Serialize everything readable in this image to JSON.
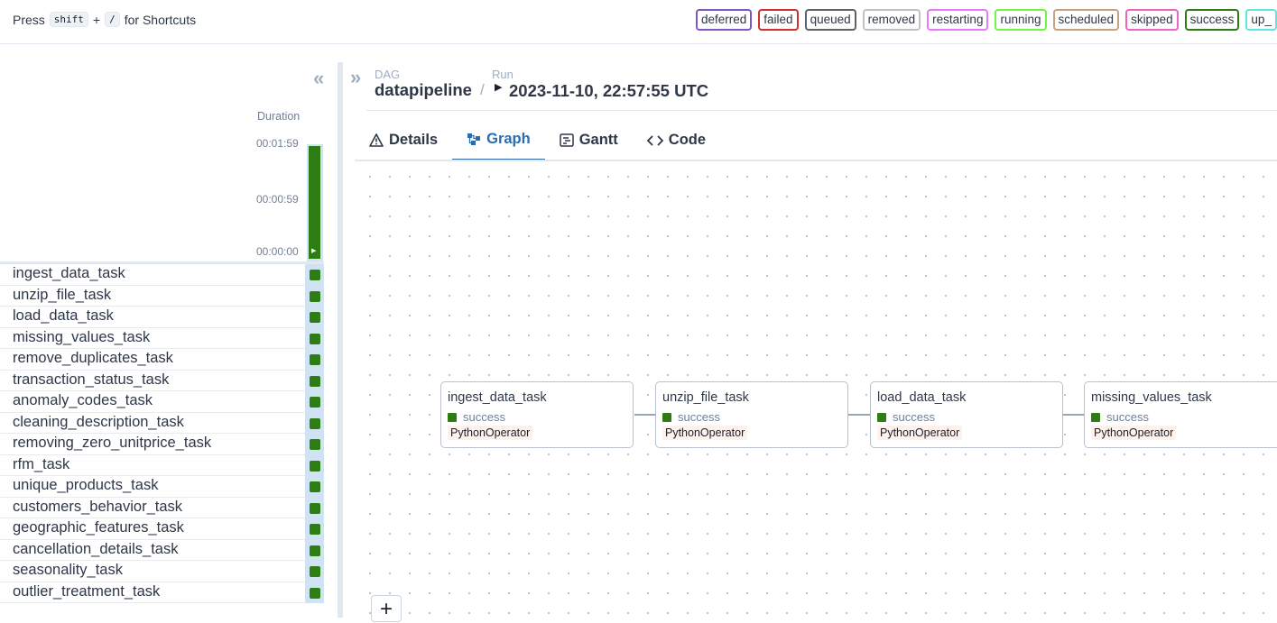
{
  "topbar": {
    "shortcut_prefix": "Press",
    "shortcut_key1": "shift",
    "shortcut_plus": "+",
    "shortcut_key2": "/",
    "shortcut_suffix": "for Shortcuts",
    "states": [
      {
        "label": "deferred",
        "color": "#7e57c2"
      },
      {
        "label": "failed",
        "color": "#d32f2f"
      },
      {
        "label": "queued",
        "color": "#616161"
      },
      {
        "label": "removed",
        "color": "#c0c0c0"
      },
      {
        "label": "restarting",
        "color": "#e879f9"
      },
      {
        "label": "running",
        "color": "#72f542"
      },
      {
        "label": "scheduled",
        "color": "#c7a27c"
      },
      {
        "label": "skipped",
        "color": "#ea65c4"
      },
      {
        "label": "success",
        "color": "#2e7d14"
      },
      {
        "label": "up_",
        "color": "#5ee7e0"
      }
    ]
  },
  "grid": {
    "duration_label": "Duration",
    "ticks": [
      "00:01:59",
      "00:00:59",
      "00:00:00"
    ],
    "run_duration_fraction": 1.0,
    "run_state_color": "#2e7d14",
    "tasks": [
      {
        "name": "ingest_data_task",
        "state": "success"
      },
      {
        "name": "unzip_file_task",
        "state": "success"
      },
      {
        "name": "load_data_task",
        "state": "success"
      },
      {
        "name": "missing_values_task",
        "state": "success"
      },
      {
        "name": "remove_duplicates_task",
        "state": "success"
      },
      {
        "name": "transaction_status_task",
        "state": "success"
      },
      {
        "name": "anomaly_codes_task",
        "state": "success"
      },
      {
        "name": "cleaning_description_task",
        "state": "success"
      },
      {
        "name": "removing_zero_unitprice_task",
        "state": "success"
      },
      {
        "name": "rfm_task",
        "state": "success"
      },
      {
        "name": "unique_products_task",
        "state": "success"
      },
      {
        "name": "customers_behavior_task",
        "state": "success"
      },
      {
        "name": "geographic_features_task",
        "state": "success"
      },
      {
        "name": "cancellation_details_task",
        "state": "success"
      },
      {
        "name": "seasonality_task",
        "state": "success"
      },
      {
        "name": "outlier_treatment_task",
        "state": "success"
      }
    ]
  },
  "header": {
    "dag_label": "DAG",
    "dag_value": "datapipeline",
    "separator": "/",
    "run_label": "Run",
    "run_value": "2023-11-10, 22:57:55 UTC"
  },
  "tabs": [
    {
      "label": "Details",
      "icon": "warning-icon"
    },
    {
      "label": "Graph",
      "icon": "graph-icon",
      "active": true
    },
    {
      "label": "Gantt",
      "icon": "gantt-icon"
    },
    {
      "label": "Code",
      "icon": "code-icon"
    }
  ],
  "graph": {
    "nodes": [
      {
        "name": "ingest_data_task",
        "status": "success",
        "operator": "PythonOperator"
      },
      {
        "name": "unzip_file_task",
        "status": "success",
        "operator": "PythonOperator"
      },
      {
        "name": "load_data_task",
        "status": "success",
        "operator": "PythonOperator"
      },
      {
        "name": "missing_values_task",
        "status": "success",
        "operator": "PythonOperator"
      }
    ],
    "zoom_in_label": "+"
  }
}
